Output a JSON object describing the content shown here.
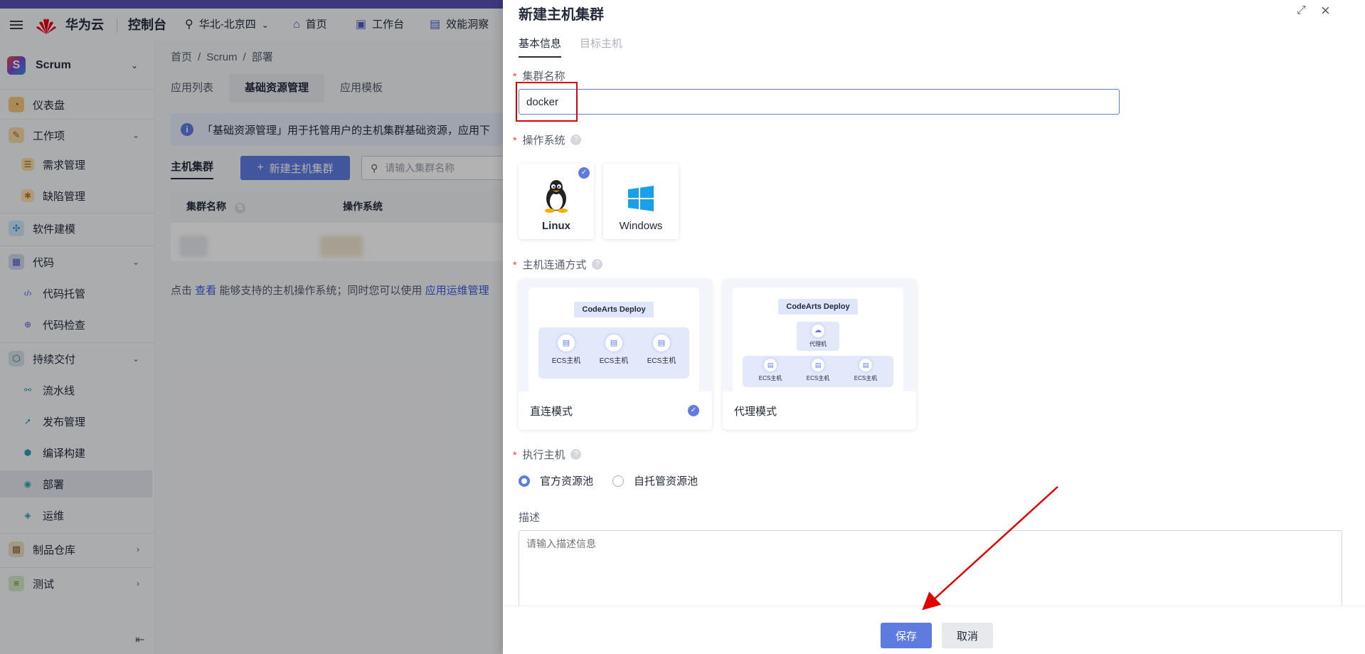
{
  "topbar": {
    "brand": "华为云",
    "console": "控制台",
    "region": "华北-北京四",
    "nav": {
      "home": "首页",
      "workbench": "工作台",
      "insight": "效能洞察"
    }
  },
  "sidebar": {
    "project": "Scrum",
    "items": [
      {
        "label": "仪表盘"
      },
      {
        "label": "工作项"
      },
      {
        "label": "需求管理"
      },
      {
        "label": "缺陷管理"
      },
      {
        "label": "软件建模"
      },
      {
        "label": "代码"
      },
      {
        "label": "代码托管"
      },
      {
        "label": "代码检查"
      },
      {
        "label": "持续交付"
      },
      {
        "label": "流水线"
      },
      {
        "label": "发布管理"
      },
      {
        "label": "编译构建"
      },
      {
        "label": "部署"
      },
      {
        "label": "运维"
      },
      {
        "label": "制品仓库"
      },
      {
        "label": "测试"
      }
    ]
  },
  "main": {
    "breadcrumb": [
      "首页",
      "/",
      "Scrum",
      "/",
      "部署"
    ],
    "tabs": [
      "应用列表",
      "基础资源管理",
      "应用模板"
    ],
    "info": "「基础资源管理」用于托管用户的主机集群基础资源，应用下",
    "subtab": "主机集群",
    "new_button": "新建主机集群",
    "search_placeholder": "请输入集群名称",
    "columns": [
      "集群名称",
      "操作系统"
    ],
    "hint_pre": "点击",
    "hint_link1": "查看",
    "hint_mid": "能够支持的主机操作系统；同时您可以使用",
    "hint_link2": "应用运维管理"
  },
  "drawer": {
    "title": "新建主机集群",
    "tabs": [
      "基本信息",
      "目标主机"
    ],
    "cluster_name_label": "集群名称",
    "cluster_name_value": "docker",
    "os_label": "操作系统",
    "os_options": [
      "Linux",
      "Windows"
    ],
    "connect_label": "主机连通方式",
    "modes": [
      {
        "label": "直连模式",
        "deploy": "CodeArts Deploy",
        "nodes": [
          "ECS主机",
          "ECS主机",
          "ECS主机"
        ]
      },
      {
        "label": "代理模式",
        "deploy": "CodeArts Deploy",
        "proxy": "代理机",
        "nodes": [
          "ECS主机",
          "ECS主机",
          "ECS主机"
        ]
      }
    ],
    "exec_label": "执行主机",
    "exec_options": [
      "官方资源池",
      "自托管资源池"
    ],
    "desc_label": "描述",
    "desc_placeholder": "请输入描述信息",
    "save": "保存",
    "cancel": "取消"
  },
  "colors": {
    "accent": "#5e7ce0",
    "highlight": "#e00000"
  }
}
